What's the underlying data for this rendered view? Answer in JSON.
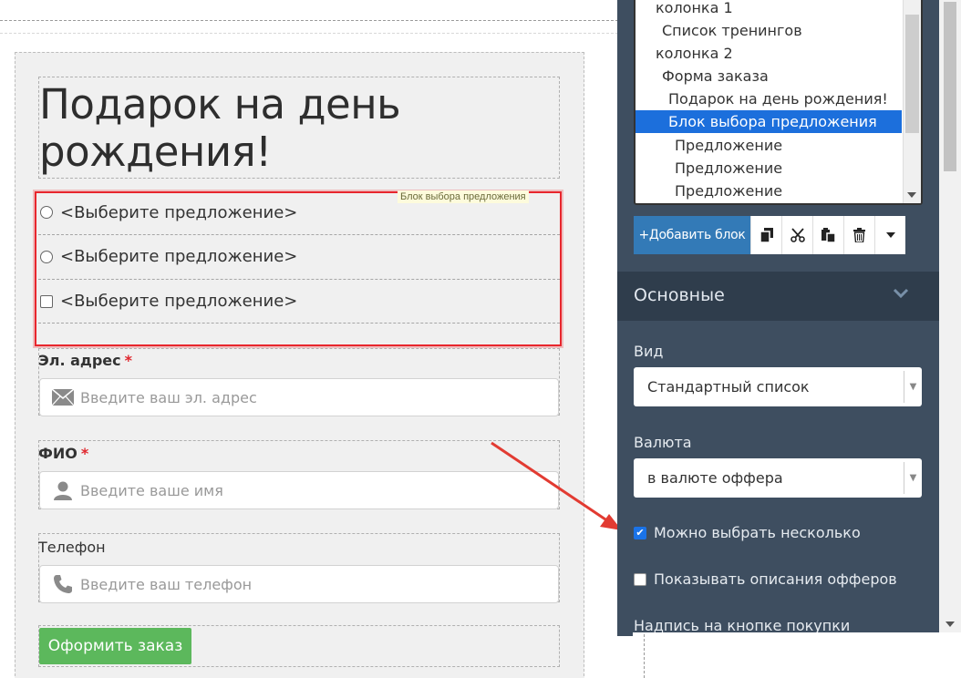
{
  "canvas": {
    "title": "Подарок на день рождения!",
    "selection_tag": "Блок выбора предложения",
    "offers": [
      {
        "label": "<Выберите предложение>",
        "control": "radio"
      },
      {
        "label": "<Выберите предложение>",
        "control": "radio"
      },
      {
        "label": "<Выберите предложение>",
        "control": "checkbox"
      }
    ],
    "email": {
      "label": "Эл. адрес",
      "required": "*",
      "placeholder": "Введите ваш эл. адрес",
      "icon": "envelope-icon"
    },
    "name": {
      "label": "ФИО",
      "required": "*",
      "placeholder": "Введите ваше имя",
      "icon": "user-icon"
    },
    "phone": {
      "label": "Телефон",
      "placeholder": "Введите ваш телефон",
      "icon": "phone-icon"
    },
    "submit_label": "Оформить заказ"
  },
  "tree": {
    "items": [
      {
        "label": "колонка 1",
        "indent": 0
      },
      {
        "label": "Список тренингов",
        "indent": 1
      },
      {
        "label": "колонка 2",
        "indent": 0
      },
      {
        "label": "Форма заказа",
        "indent": 1
      },
      {
        "label": "Подарок на день рождения!",
        "indent": 2
      },
      {
        "label": "Блок выбора предложения",
        "indent": 2,
        "selected": true
      },
      {
        "label": "Предложение",
        "indent": 3
      },
      {
        "label": "Предложение",
        "indent": 3
      },
      {
        "label": "Предложение",
        "indent": 3
      }
    ]
  },
  "toolbar": {
    "add_label": "+Добавить блок",
    "icons": [
      "copy-icon",
      "cut-icon",
      "paste-icon",
      "trash-icon",
      "dropdown-icon"
    ]
  },
  "panel": {
    "section_title": "Основные",
    "view_label": "Вид",
    "view_value": "Стандартный список",
    "currency_label": "Валюта",
    "currency_value": "в валюте оффера",
    "multi_label": "Можно выбрать несколько",
    "multi_checked": true,
    "desc_label": "Показывать описания офферов",
    "desc_checked": false,
    "button_caption_label": "Надпись на кнопке покупки"
  },
  "colors": {
    "accent_blue": "#1c6fdc",
    "panel_bg": "#3e4e60",
    "panel_head": "#2f3d4c",
    "submit_green": "#5cb85c",
    "highlight_red": "#e8262d"
  }
}
